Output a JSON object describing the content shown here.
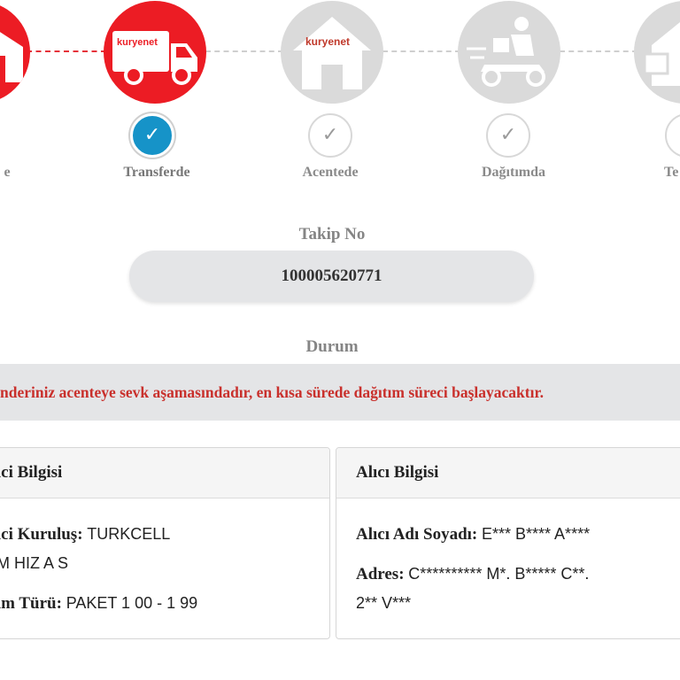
{
  "stepper": {
    "steps": [
      {
        "label": "e",
        "state": "done",
        "icon": "warehouse-icon"
      },
      {
        "label": "Transferde",
        "state": "current",
        "icon": "truck-icon",
        "brand": "kuryenet"
      },
      {
        "label": "Acentede",
        "state": "pending",
        "icon": "house-icon",
        "brand": "kuryenet"
      },
      {
        "label": "Dağıtımda",
        "state": "pending",
        "icon": "scooter-courier-icon"
      },
      {
        "label": "Te",
        "state": "pending",
        "icon": "delivered-house-icon"
      }
    ],
    "check_glyph": "✓"
  },
  "tracking": {
    "label": "Takip No",
    "number": "100005620771"
  },
  "status": {
    "label": "Durum",
    "message": "nderiniz acenteye sevk aşamasındadır, en kısa sürede dağıtım süreci başlayacaktır."
  },
  "sender": {
    "title": "erici Bilgisi",
    "institution_label": "erici Kuruluş:",
    "institution_value": "TURKCELL",
    "institution_value_line2": "SIM HIZ A S",
    "type_label": "erim Türü:",
    "type_value": "PAKET 1 00 - 1 99"
  },
  "receiver": {
    "title": "Alıcı Bilgisi",
    "name_label": "Alıcı Adı Soyadı:",
    "name_value": "E*** B**** A****",
    "address_label": "Adres:",
    "address_value": "C********** M*. B***** C**.",
    "address_value_line2": "2** V***"
  },
  "colors": {
    "accent_red": "#ec1c24",
    "check_blue": "#1693c8",
    "inactive_gray": "#dadada",
    "status_text": "#c9302c"
  }
}
